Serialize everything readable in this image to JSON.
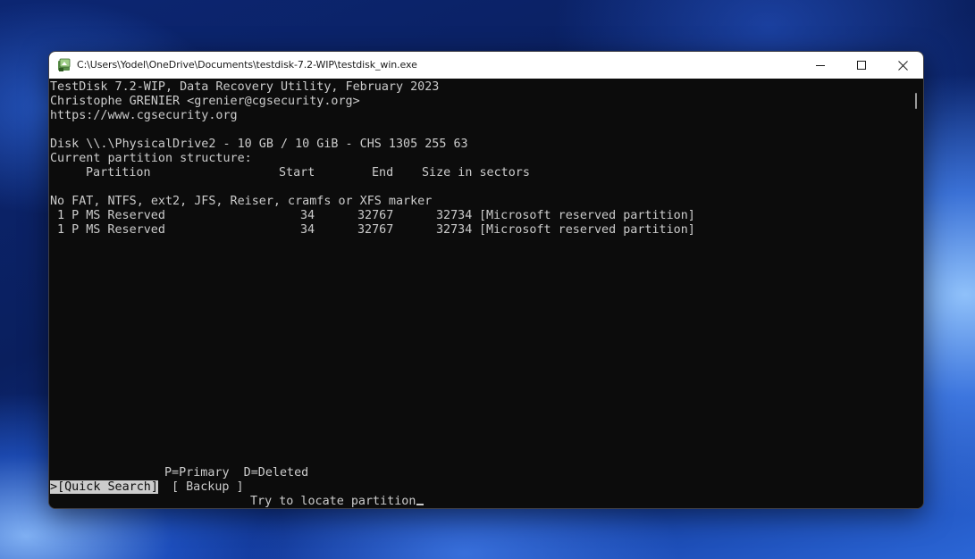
{
  "window": {
    "title": "C:\\Users\\Yodel\\OneDrive\\Documents\\testdisk-7.2-WIP\\testdisk_win.exe",
    "icon": "testdisk-app-icon",
    "controls": {
      "minimize": "minimize-icon",
      "maximize": "maximize-icon",
      "close": "close-icon"
    }
  },
  "console": {
    "header": [
      "TestDisk 7.2-WIP, Data Recovery Utility, February 2023",
      "Christophe GRENIER <grenier@cgsecurity.org>",
      "https://www.cgsecurity.org"
    ],
    "disk_info": "Disk \\\\.\\PhysicalDrive2 - 10 GB / 10 GiB - CHS 1305 255 63",
    "structure_label": "Current partition structure:",
    "columns": {
      "partition": "Partition",
      "start": "Start",
      "end": "End",
      "size": "Size in sectors"
    },
    "warning": "No FAT, NTFS, ext2, JFS, Reiser, cramfs or XFS marker",
    "partitions": [
      {
        "entry": "1 P MS Reserved",
        "start": "34",
        "end": "32767",
        "size": "32734",
        "label": "[Microsoft reserved partition]"
      },
      {
        "entry": "1 P MS Reserved",
        "start": "34",
        "end": "32767",
        "size": "32734",
        "label": "[Microsoft reserved partition]"
      }
    ],
    "legend": "P=Primary  D=Deleted",
    "menu": {
      "pointer": ">",
      "quick_search": "[Quick Search]",
      "backup": "[ Backup ]"
    },
    "hint": "Try to locate partition"
  },
  "colors": {
    "console_bg": "#0c0c0c",
    "console_fg": "#cccccc",
    "titlebar_bg": "#ffffff"
  }
}
